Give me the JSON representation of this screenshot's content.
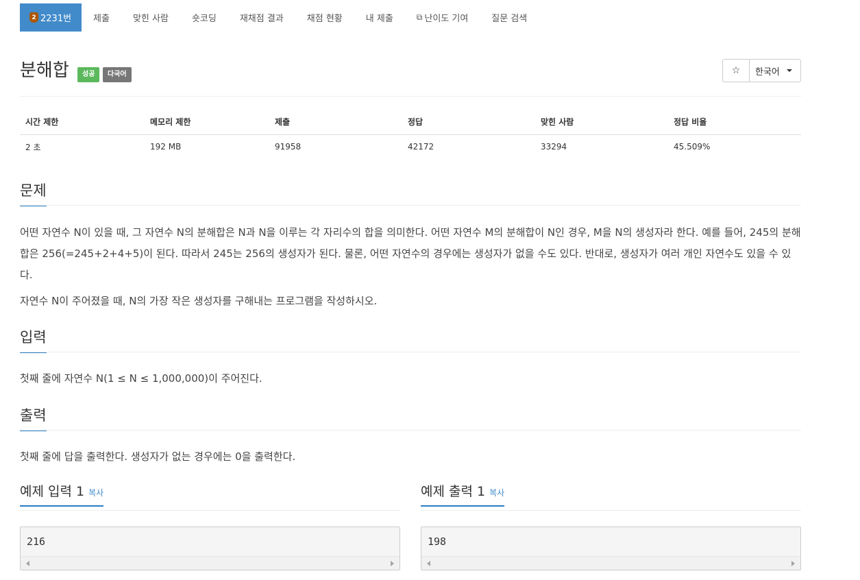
{
  "nav": {
    "problem_tab": {
      "tier": "2",
      "label": "2231번"
    },
    "tabs": [
      "제출",
      "맞힌 사람",
      "숏코딩",
      "재채점 결과",
      "채점 현황",
      "내 제출"
    ],
    "difficulty_tab": "난이도 기여",
    "qna_tab": "질문 검색"
  },
  "problem": {
    "title": "분해합",
    "labels": {
      "status": "성공",
      "multilang": "다국어"
    },
    "star": "☆",
    "language": "한국어"
  },
  "info_table": {
    "headers": [
      "시간 제한",
      "메모리 제한",
      "제출",
      "정답",
      "맞힌 사람",
      "정답 비율"
    ],
    "values": [
      "2 초",
      "192 MB",
      "91958",
      "42172",
      "33294",
      "45.509%"
    ]
  },
  "sections": {
    "description": {
      "title": "문제",
      "paragraphs": [
        "어떤 자연수 N이 있을 때, 그 자연수 N의 분해합은 N과 N을 이루는 각 자리수의 합을 의미한다. 어떤 자연수 M의 분해합이 N인 경우, M을 N의 생성자라 한다. 예를 들어, 245의 분해합은 256(=245+2+4+5)이 된다. 따라서 245는 256의 생성자가 된다. 물론, 어떤 자연수의 경우에는 생성자가 없을 수도 있다. 반대로, 생성자가 여러 개인 자연수도 있을 수 있다.",
        "자연수 N이 주어졌을 때, N의 가장 작은 생성자를 구해내는 프로그램을 작성하시오."
      ]
    },
    "input": {
      "title": "입력",
      "text": "첫째 줄에 자연수 N(1 ≤ N ≤ 1,000,000)이 주어진다."
    },
    "output": {
      "title": "출력",
      "text": "첫째 줄에 답을 출력한다. 생성자가 없는 경우에는 0을 출력한다."
    }
  },
  "samples": {
    "copy_label": "복사",
    "input": {
      "title": "예제 입력 1",
      "value": "216"
    },
    "output": {
      "title": "예제 출력 1",
      "value": "198"
    }
  },
  "colors": {
    "active_tab": "#428bca",
    "success_label": "#5cb85c",
    "multilang_label": "#777777",
    "tier_badge": "#ad5600",
    "heading_underline": "#2a7cc2"
  }
}
